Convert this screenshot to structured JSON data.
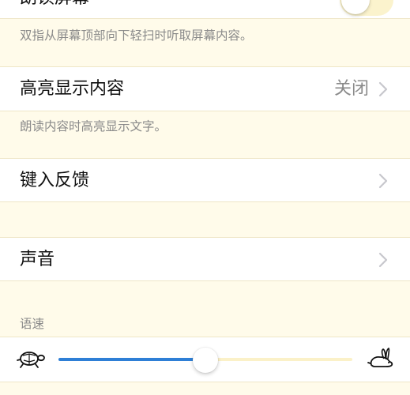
{
  "rows": {
    "speak_screen": {
      "label": "朗读屏幕",
      "footer": "双指从屏幕顶部向下轻扫时听取屏幕内容。",
      "toggle_on": false
    },
    "highlight_content": {
      "label": "高亮显示内容",
      "value": "关闭",
      "footer": "朗读内容时高亮显示文字。"
    },
    "typing_feedback": {
      "label": "键入反馈"
    },
    "sounds": {
      "label": "声音"
    }
  },
  "speaking_rate": {
    "header": "语速",
    "level": 0.5,
    "min_icon": "turtle-icon",
    "max_icon": "rabbit-icon"
  },
  "colors": {
    "background": "#fffbea",
    "accent": "#2e7fd6",
    "secondary_text": "#8a8a8a",
    "separator": "#efe6c7"
  }
}
